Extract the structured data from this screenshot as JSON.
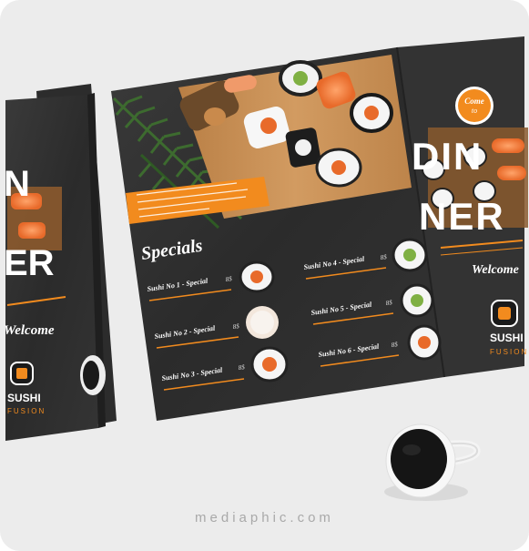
{
  "scene": {
    "background": "#ececec",
    "accent": "#f28b1e",
    "board_dark": "#2e2e2e",
    "wood": "#c99155"
  },
  "left_panel": {
    "headline_lines": [
      "N",
      "ER"
    ],
    "welcome": "Welcome",
    "brand_top": "SUSHI",
    "brand_bottom": "FUSION"
  },
  "center_panel": {
    "intro_bar_visible": true,
    "specials_title": "Specials",
    "menu_items": [
      {
        "name": "Sushi No 1 - Special",
        "price": "8$"
      },
      {
        "name": "Sushi No 2 - Special",
        "price": "8$"
      },
      {
        "name": "Sushi No 3 - Special",
        "price": "8$"
      },
      {
        "name": "Sushi No 4 - Special",
        "price": "8$"
      },
      {
        "name": "Sushi No 5 - Special",
        "price": "8$"
      },
      {
        "name": "Sushi No 6 - Special",
        "price": "8$"
      }
    ]
  },
  "right_panel": {
    "badge_line1": "Come",
    "badge_line2": "to",
    "headline_line1": "DIN",
    "headline_line2": "NER",
    "welcome": "Welcome",
    "brand_top": "SUSHI",
    "brand_bottom": "FUSION"
  },
  "watermark": "mediaphic.com",
  "icons": {
    "logo": "sushi-fusion-logo-icon",
    "coffee": "coffee-cup-icon"
  }
}
